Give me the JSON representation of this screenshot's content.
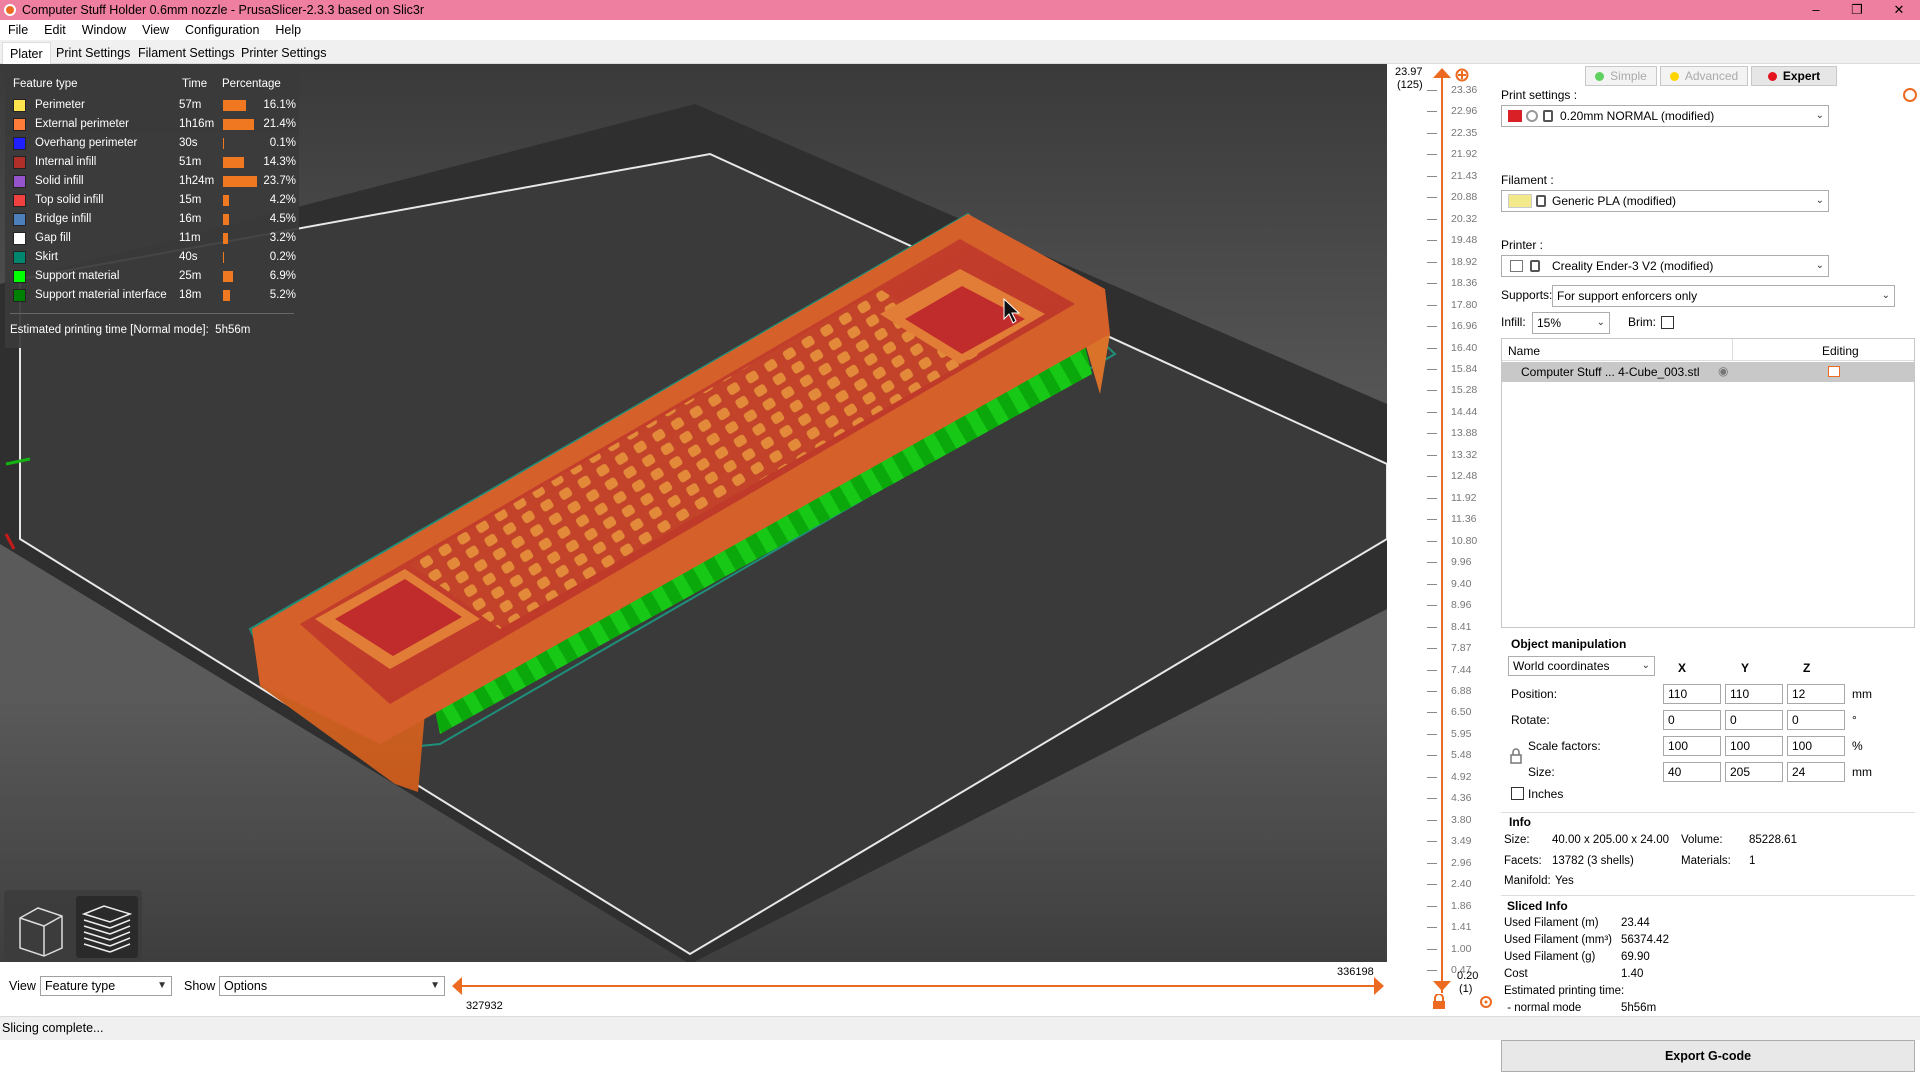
{
  "window": {
    "title": "Computer Stuff Holder 0.6mm nozzle - PrusaSlicer-2.3.3 based on Slic3r",
    "controls": {
      "minimize": "–",
      "restore": "❐",
      "close": "✕"
    }
  },
  "menu": [
    "File",
    "Edit",
    "Window",
    "View",
    "Configuration",
    "Help"
  ],
  "tabs": [
    "Plater",
    "Print Settings",
    "Filament Settings",
    "Printer Settings"
  ],
  "legend": {
    "headers": {
      "feature": "Feature type",
      "time": "Time",
      "percentage": "Percentage"
    },
    "rows": [
      {
        "name": "Perimeter",
        "time": "57m",
        "pct": "16.1%",
        "value": 16.1,
        "color": "#ffe54d"
      },
      {
        "name": "External perimeter",
        "time": "1h16m",
        "pct": "21.4%",
        "value": 21.4,
        "color": "#ff7d38"
      },
      {
        "name": "Overhang perimeter",
        "time": "30s",
        "pct": "0.1%",
        "value": 0.1,
        "color": "#1f1fff"
      },
      {
        "name": "Internal infill",
        "time": "51m",
        "pct": "14.3%",
        "value": 14.3,
        "color": "#b03029"
      },
      {
        "name": "Solid infill",
        "time": "1h24m",
        "pct": "23.7%",
        "value": 23.7,
        "color": "#9654cc"
      },
      {
        "name": "Top solid infill",
        "time": "15m",
        "pct": "4.2%",
        "value": 4.2,
        "color": "#f04040"
      },
      {
        "name": "Bridge infill",
        "time": "16m",
        "pct": "4.5%",
        "value": 4.5,
        "color": "#4d80ba"
      },
      {
        "name": "Gap fill",
        "time": "11m",
        "pct": "3.2%",
        "value": 3.2,
        "color": "#ffffff"
      },
      {
        "name": "Skirt",
        "time": "40s",
        "pct": "0.2%",
        "value": 0.2,
        "color": "#00876e"
      },
      {
        "name": "Support material",
        "time": "25m",
        "pct": "6.9%",
        "value": 6.9,
        "color": "#00ff00"
      },
      {
        "name": "Support material interface",
        "time": "18m",
        "pct": "5.2%",
        "value": 5.2,
        "color": "#008000"
      }
    ],
    "estimated_label": "Estimated printing time [Normal mode]:",
    "estimated_value": "5h56m"
  },
  "bottom": {
    "view_label": "View",
    "view_value": "Feature type",
    "show_label": "Show",
    "show_value": "Options",
    "slider_right_value": "336198",
    "slider_left_value": "327932"
  },
  "vslider": {
    "top_value": "23.97",
    "top_layer": "(125)",
    "bottom_value": "0.20",
    "bottom_layer": "(1)",
    "ticks": [
      "23.36",
      "22.96",
      "22.35",
      "21.92",
      "21.43",
      "20.88",
      "20.32",
      "19.48",
      "18.92",
      "18.36",
      "17.80",
      "16.96",
      "16.40",
      "15.84",
      "15.28",
      "14.44",
      "13.88",
      "13.32",
      "12.48",
      "11.92",
      "11.36",
      "10.80",
      "9.96",
      "9.40",
      "8.96",
      "8.41",
      "7.87",
      "7.44",
      "6.88",
      "6.50",
      "5.95",
      "5.48",
      "4.92",
      "4.36",
      "3.80",
      "3.49",
      "2.96",
      "2.40",
      "1.86",
      "1.41",
      "1.00",
      "0.47"
    ]
  },
  "mode": {
    "simple": "Simple",
    "advanced": "Advanced",
    "expert": "Expert"
  },
  "print_settings": {
    "label": "Print settings :",
    "value": "0.20mm NORMAL (modified)"
  },
  "filament": {
    "label": "Filament :",
    "value": "Generic PLA (modified)"
  },
  "printer": {
    "label": "Printer :",
    "value": "Creality Ender-3 V2 (modified)"
  },
  "supports": {
    "label": "Supports:",
    "value": "For support enforcers only"
  },
  "infill": {
    "label": "Infill:",
    "value": "15%"
  },
  "brim": {
    "label": "Brim:"
  },
  "object_list": {
    "col_name": "Name",
    "col_editing": "Editing",
    "items": [
      {
        "name": "Computer Stuff ... 4-Cube_003.stl"
      }
    ]
  },
  "object_manipulation": {
    "title": "Object manipulation",
    "coords": "World coordinates",
    "axes": [
      "X",
      "Y",
      "Z"
    ],
    "position": {
      "label": "Position:",
      "x": "110",
      "y": "110",
      "z": "12",
      "unit": "mm"
    },
    "rotate": {
      "label": "Rotate:",
      "x": "0",
      "y": "0",
      "z": "0",
      "unit": "°"
    },
    "scale": {
      "label": "Scale factors:",
      "x": "100",
      "y": "100",
      "z": "100",
      "unit": "%"
    },
    "size": {
      "label": "Size:",
      "x": "40",
      "y": "205",
      "z": "24",
      "unit": "mm"
    },
    "inches": "Inches"
  },
  "info": {
    "title": "Info",
    "size_label": "Size:",
    "size_value": "40.00 x 205.00 x 24.00",
    "volume_label": "Volume:",
    "volume_value": "85228.61",
    "facets_label": "Facets:",
    "facets_value": "13782 (3 shells)",
    "materials_label": "Materials:",
    "materials_value": "1",
    "manifold_label": "Manifold:",
    "manifold_value": "Yes"
  },
  "sliced_info": {
    "title": "Sliced Info",
    "rows": [
      {
        "k": "Used Filament (m)",
        "v": "23.44"
      },
      {
        "k": "Used Filament (mm³)",
        "v": "56374.42"
      },
      {
        "k": "Used Filament (g)",
        "v": "69.90"
      },
      {
        "k": "Cost",
        "v": "1.40"
      },
      {
        "k": "Estimated printing time:",
        "v": ""
      },
      {
        "k": " - normal mode",
        "v": "5h56m"
      }
    ]
  },
  "export_button": "Export G-code",
  "status": "Slicing complete..."
}
